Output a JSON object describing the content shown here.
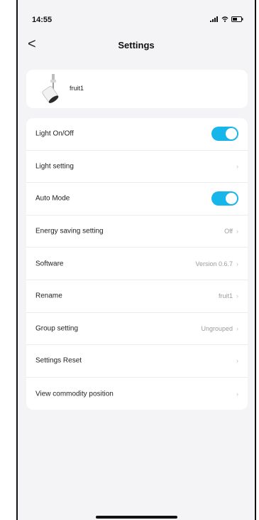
{
  "status_bar": {
    "time": "14:55"
  },
  "cut_digit": "0",
  "nav": {
    "back_label": "<",
    "title": "Settings"
  },
  "device": {
    "name": "fruit1",
    "icon": "spotlight-icon"
  },
  "settings": [
    {
      "label": "Light On/Off",
      "type": "toggle",
      "on": true
    },
    {
      "label": "Light setting",
      "type": "chevron",
      "value": ""
    },
    {
      "label": "Auto Mode",
      "type": "toggle",
      "on": true
    },
    {
      "label": "Energy saving setting",
      "type": "chevron",
      "value": "Off"
    },
    {
      "label": "Software",
      "type": "chevron",
      "value": "Version 0.6.7"
    },
    {
      "label": "Rename",
      "type": "chevron",
      "value": "fruit1"
    },
    {
      "label": "Group setting",
      "type": "chevron",
      "value": "Ungrouped"
    },
    {
      "label": "Settings Reset",
      "type": "chevron",
      "value": ""
    },
    {
      "label": "View commodity position",
      "type": "chevron",
      "value": ""
    }
  ],
  "colors": {
    "accent": "#16b6ea",
    "background": "#f4f4f6",
    "card": "#ffffff"
  }
}
